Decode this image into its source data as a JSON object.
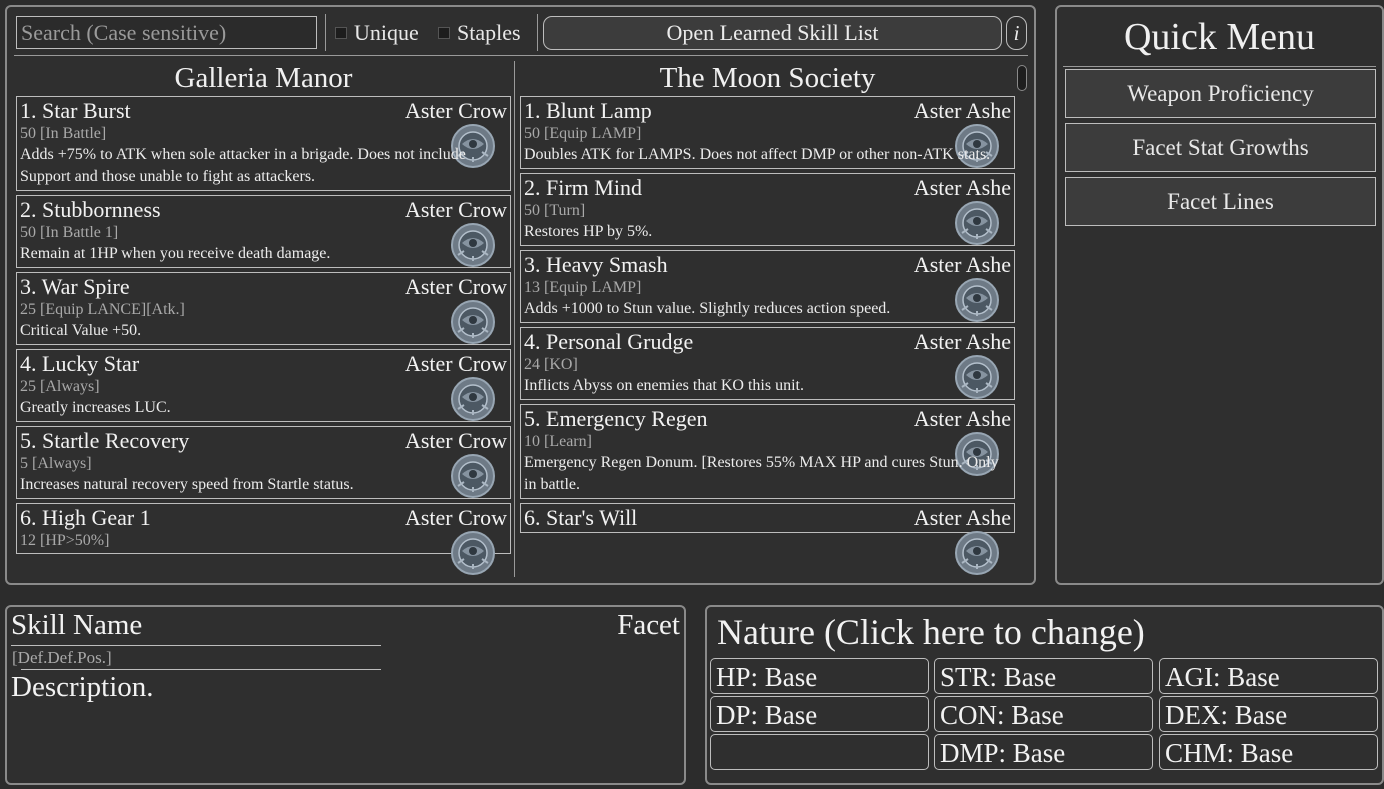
{
  "search": {
    "placeholder": "Search (Case sensitive)",
    "value": ""
  },
  "filters": {
    "unique_label": "Unique",
    "staples_label": "Staples"
  },
  "toolbar": {
    "open_list_label": "Open Learned Skill List",
    "info_label": "i"
  },
  "columns": [
    {
      "title": "Galleria Manor",
      "skills": [
        {
          "name": "1. Star Burst",
          "facet": "Aster Crow",
          "cost": "50 [In Battle]",
          "desc": "Adds +75% to ATK when sole attacker in a brigade. Does not include Support and those unable to fight as attackers."
        },
        {
          "name": "2. Stubbornness",
          "facet": "Aster Crow",
          "cost": "50 [In Battle 1]",
          "desc": "Remain at 1HP when you receive death damage."
        },
        {
          "name": "3. War Spire",
          "facet": "Aster Crow",
          "cost": "25 [Equip LANCE][Atk.]",
          "desc": "Critical Value +50."
        },
        {
          "name": "4. Lucky Star",
          "facet": "Aster Crow",
          "cost": "25 [Always]",
          "desc": "Greatly increases LUC."
        },
        {
          "name": "5. Startle Recovery",
          "facet": "Aster Crow",
          "cost": "5 [Always]",
          "desc": "Increases natural recovery speed from Startle status."
        },
        {
          "name": "6. High Gear 1",
          "facet": "Aster Crow",
          "cost": "12 [HP>50%]",
          "desc": ""
        }
      ]
    },
    {
      "title": "The Moon Society",
      "skills": [
        {
          "name": "1. Blunt Lamp",
          "facet": "Aster Ashe",
          "cost": "50 [Equip LAMP]",
          "desc": "Doubles ATK for LAMPS. Does not affect DMP or other non-ATK stats."
        },
        {
          "name": "2. Firm Mind",
          "facet": "Aster Ashe",
          "cost": "50 [Turn]",
          "desc": "Restores HP by 5%."
        },
        {
          "name": "3. Heavy Smash",
          "facet": "Aster Ashe",
          "cost": "13 [Equip LAMP]",
          "desc": "Adds +1000 to Stun value. Slightly reduces action speed."
        },
        {
          "name": "4. Personal Grudge",
          "facet": "Aster Ashe",
          "cost": "24 [KO]",
          "desc": "Inflicts Abyss on enemies that KO this unit."
        },
        {
          "name": "5. Emergency Regen",
          "facet": "Aster Ashe",
          "cost": "10 [Learn]",
          "desc": "Emergency Regen Donum. [Restores 55% MAX HP and cures Stun. Only in battle."
        },
        {
          "name": "6. Star's Will",
          "facet": "Aster Ashe",
          "cost": "",
          "desc": ""
        }
      ]
    }
  ],
  "quick_menu": {
    "title": "Quick Menu",
    "items": [
      "Weapon Proficiency",
      "Facet Stat Growths",
      "Facet Lines"
    ]
  },
  "detail": {
    "name": "Skill Name",
    "facet": "Facet",
    "cost": "[Def.Def.Pos.]",
    "desc": "Description."
  },
  "nature": {
    "title": "Nature (Click here to change)",
    "cells": [
      "HP: Base",
      "STR: Base",
      "AGI: Base",
      "DP: Base",
      "CON: Base",
      "DEX: Base",
      "",
      "DMP: Base",
      "CHM: Base"
    ]
  }
}
